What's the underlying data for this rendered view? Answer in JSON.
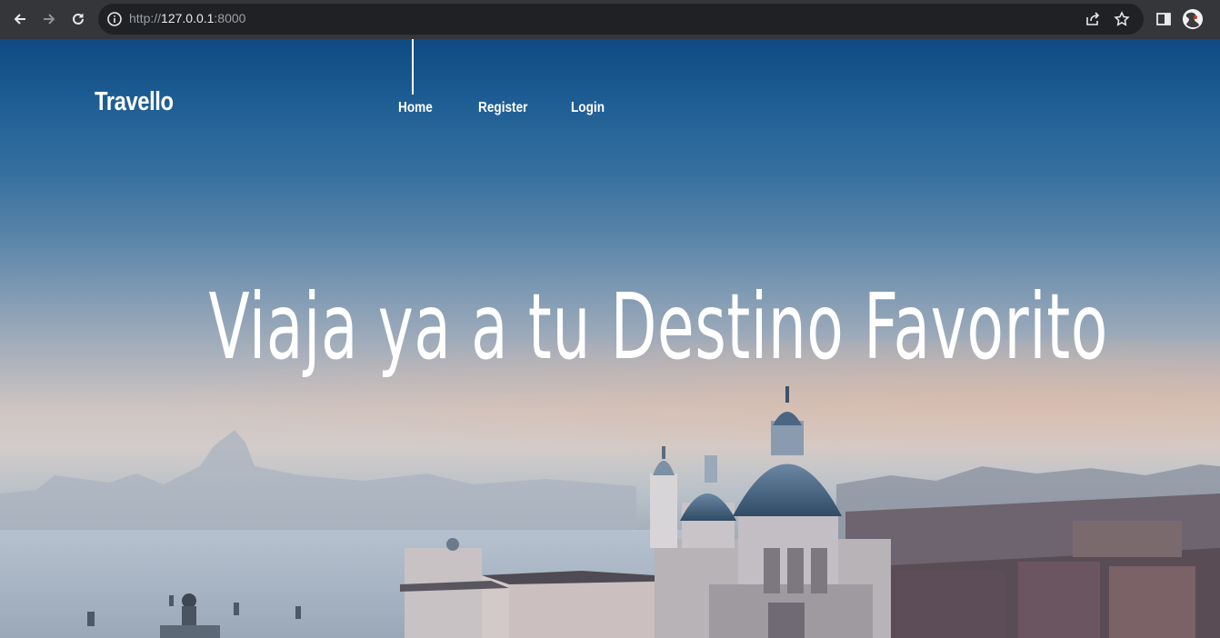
{
  "browser": {
    "url_scheme": "http://",
    "url_host": "127.0.0.1",
    "url_port": ":8000",
    "icons": {
      "back": "back-arrow-icon",
      "forward": "forward-arrow-icon",
      "reload": "reload-icon",
      "info": "info-icon",
      "share": "share-icon",
      "bookmark": "star-icon",
      "side_panel": "side-panel-icon",
      "profile": "profile-avatar"
    }
  },
  "site": {
    "brand": "Travello",
    "nav": [
      {
        "label": "Home",
        "active": true
      },
      {
        "label": "Register",
        "active": false
      },
      {
        "label": "Login",
        "active": false
      }
    ],
    "hero_title": "Viaja ya a tu Destino Favorito"
  },
  "colors": {
    "chrome_bg": "#35363a",
    "omnibox_bg": "#202124",
    "text_white": "#ffffff",
    "sky_top": "#0f4a82"
  }
}
